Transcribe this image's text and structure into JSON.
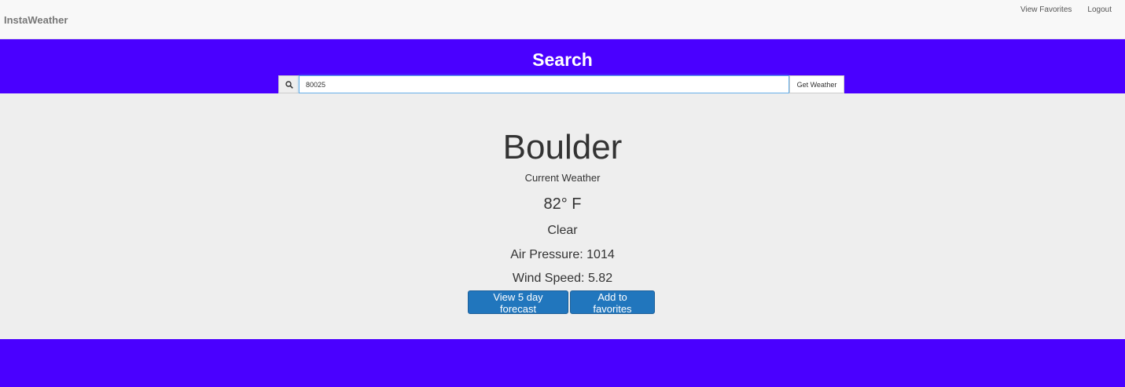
{
  "navbar": {
    "brand": "InstaWeather",
    "links": [
      "View Favorites",
      "Logout"
    ]
  },
  "search": {
    "title": "Search",
    "input_value": "80025",
    "button_label": "Get Weather",
    "icon": "search-icon"
  },
  "weather": {
    "city": "Boulder",
    "subtitle": "Current Weather",
    "temperature": "82° F",
    "condition": "Clear",
    "air_pressure": "Air Pressure: 1014",
    "wind_speed": "Wind Speed: 5.82"
  },
  "actions": {
    "forecast_label": "View 5 day forecast",
    "favorite_label": "Add to favorites"
  },
  "colors": {
    "accent_purple": "#4a00ff",
    "button_blue": "#2176bd"
  }
}
